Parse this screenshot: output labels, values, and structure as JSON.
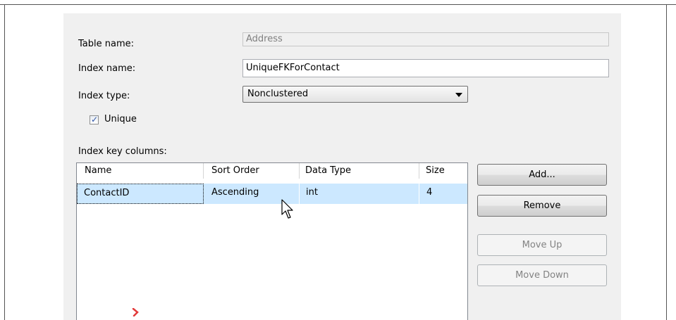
{
  "form": {
    "table_name_label": "Table name:",
    "table_name_value": "Address",
    "index_name_label": "Index name:",
    "index_name_value": "UniqueFKForContact",
    "index_type_label": "Index type:",
    "index_type_value": "Nonclustered",
    "unique_label": "Unique",
    "unique_checked": true,
    "key_columns_label": "Index key columns:"
  },
  "grid": {
    "columns": [
      "Name",
      "Sort Order",
      "Data Type",
      "Size"
    ],
    "rows": [
      {
        "name": "ContactID",
        "sort_order": "Ascending",
        "data_type": "int",
        "size": "4",
        "selected": true
      }
    ]
  },
  "buttons": {
    "add": "Add...",
    "remove": "Remove",
    "move_up": "Move Up",
    "move_down": "Move Down"
  },
  "colors": {
    "selection": "#cce8ff",
    "dialog_bg": "#f0f0f0",
    "check_mark": "#3057a8"
  },
  "icons": {
    "checkbox_mark": "✓",
    "cursor": "arrow-cursor-icon"
  }
}
